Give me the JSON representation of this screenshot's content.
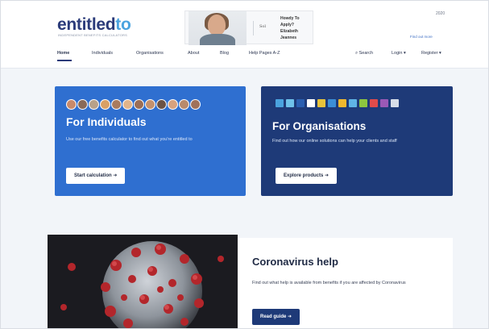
{
  "header": {
    "logo_main": "entitled",
    "logo_accent": "to",
    "tagline": "INDEPENDENT BENEFITS CALCULATORS",
    "ad": {
      "text_line1": "Howdy To Apply?",
      "text_line2": "Elizabeth Jeannes",
      "signature": "Sol"
    },
    "top_right": "2020",
    "find_out": "Find out more"
  },
  "nav": {
    "items": [
      "Home",
      "Individuals",
      "Organisations",
      "About",
      "Blog",
      "Help Pages A-Z"
    ],
    "search": "Search",
    "login": "Login",
    "register": "Register"
  },
  "individuals": {
    "title": "For Individuals",
    "description": "Use our free benefits calculator to find out what you're entitled to",
    "button": "Start calculation"
  },
  "organisations": {
    "title": "For Organisations",
    "description": "Find out how our online solutions can help your clients and staff",
    "button": "Explore products"
  },
  "coronavirus": {
    "title": "Coronavirus help",
    "description": "Find out what help is available from benefits if you are affected by Coronavirus",
    "button": "Read guide"
  },
  "colors": {
    "individuals_bg": "#2f6fd0",
    "organisations_bg": "#1e3a78",
    "accent": "#4aa3df"
  }
}
